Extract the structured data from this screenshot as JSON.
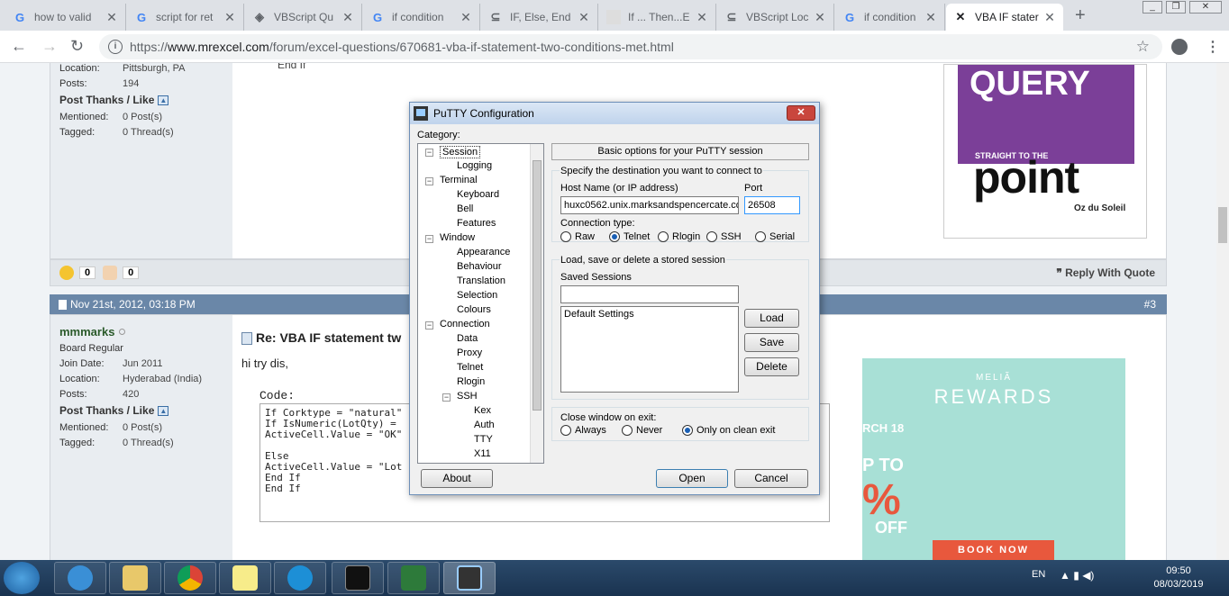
{
  "browser": {
    "tabs": [
      {
        "title": "how to valid",
        "icon": "G",
        "color": "#4285f4"
      },
      {
        "title": "script for ret",
        "icon": "G",
        "color": "#4285f4"
      },
      {
        "title": "VBScript Qu",
        "icon": "◈",
        "color": "#555"
      },
      {
        "title": "if condition",
        "icon": "G",
        "color": "#4285f4"
      },
      {
        "title": "IF, Else, End",
        "icon": "⊆",
        "color": "#555"
      },
      {
        "title": "If ... Then...E",
        "icon": "▫",
        "color": "#888"
      },
      {
        "title": "VBScript Loc",
        "icon": "⊆",
        "color": "#555"
      },
      {
        "title": "if condition",
        "icon": "G",
        "color": "#4285f4"
      },
      {
        "title": "VBA IF stater",
        "icon": "✕",
        "color": "#555"
      }
    ],
    "new_tab": "+",
    "url_prefix": "https://",
    "url_domain": "www.mrexcel.com",
    "url_path": "/forum/excel-questions/670681-vba-if-statement-two-conditions-met.html"
  },
  "post1": {
    "location_label": "Location:",
    "location": "Pittsburgh, PA",
    "posts_label": "Posts:",
    "posts": "194",
    "thanks": "Post Thanks / Like",
    "mentioned_label": "Mentioned:",
    "mentioned": "0 Post(s)",
    "tagged_label": "Tagged:",
    "tagged": "0 Thread(s)",
    "end_text": "End If",
    "likes": "0",
    "thumbs": "0",
    "reply_with_quote": "Reply With Quote"
  },
  "post2": {
    "date": "Nov 21st, 2012, 03:18 PM",
    "number": "#3",
    "username": "mmmarks",
    "rank": "Board Regular",
    "join_label": "Join Date:",
    "join": "Jun 2011",
    "location_label": "Location:",
    "location": "Hyderabad (India)",
    "posts_label": "Posts:",
    "posts": "420",
    "thanks": "Post Thanks / Like",
    "mentioned_label": "Mentioned:",
    "mentioned": "0 Post(s)",
    "tagged_label": "Tagged:",
    "tagged": "0 Thread(s)",
    "title": "Re: VBA IF statement tw",
    "body": "hi try dis,",
    "code_label": "Code:",
    "code": "If Corktype = \"natural\"\nIf IsNumeric(LotQty) =\nActiveCell.Value = \"OK\"\n\nElse\nActiveCell.Value = \"Lot\nEnd If\nEnd If"
  },
  "ads": {
    "query": "QUERY",
    "straight": "STRAIGHT TO THE",
    "point": "point",
    "author": "Oz du Soleil",
    "melia": "MELIÃ",
    "rewards": "REWARDS",
    "march": "RCH 18",
    "pto": "P TO",
    "pct": "%",
    "off": "OFF",
    "book": "BOOK NOW"
  },
  "putty": {
    "title": "PuTTY Configuration",
    "close": "✕",
    "category_label": "Category:",
    "tree": [
      {
        "label": "Session",
        "level": 0,
        "exp": "−",
        "selected": true
      },
      {
        "label": "Logging",
        "level": 1
      },
      {
        "label": "Terminal",
        "level": 0,
        "exp": "−"
      },
      {
        "label": "Keyboard",
        "level": 1
      },
      {
        "label": "Bell",
        "level": 1
      },
      {
        "label": "Features",
        "level": 1
      },
      {
        "label": "Window",
        "level": 0,
        "exp": "−"
      },
      {
        "label": "Appearance",
        "level": 1
      },
      {
        "label": "Behaviour",
        "level": 1
      },
      {
        "label": "Translation",
        "level": 1
      },
      {
        "label": "Selection",
        "level": 1
      },
      {
        "label": "Colours",
        "level": 1
      },
      {
        "label": "Connection",
        "level": 0,
        "exp": "−"
      },
      {
        "label": "Data",
        "level": 1
      },
      {
        "label": "Proxy",
        "level": 1
      },
      {
        "label": "Telnet",
        "level": 1
      },
      {
        "label": "Rlogin",
        "level": 1
      },
      {
        "label": "SSH",
        "level": 1,
        "exp": "−"
      },
      {
        "label": "Kex",
        "level": 2
      },
      {
        "label": "Auth",
        "level": 2
      },
      {
        "label": "TTY",
        "level": 2
      },
      {
        "label": "X11",
        "level": 2
      }
    ],
    "section_header": "Basic options for your PuTTY session",
    "dest_label": "Specify the destination you want to connect to",
    "host_label": "Host Name (or IP address)",
    "host_value": "huxc0562.unix.marksandspencercate.co",
    "port_label": "Port",
    "port_value": "26508",
    "conn_type_label": "Connection type:",
    "conn_types": [
      "Raw",
      "Telnet",
      "Rlogin",
      "SSH",
      "Serial"
    ],
    "conn_selected": "Telnet",
    "sessions_group_label": "Load, save or delete a stored session",
    "saved_sessions_label": "Saved Sessions",
    "saved_sessions_value": "",
    "sessions": [
      "Default Settings"
    ],
    "load": "Load",
    "save": "Save",
    "delete": "Delete",
    "close_exit_label": "Close window on exit:",
    "exit_options": [
      "Always",
      "Never",
      "Only on clean exit"
    ],
    "exit_selected": "Only on clean exit",
    "about": "About",
    "open": "Open",
    "cancel": "Cancel"
  },
  "taskbar": {
    "lang": "EN",
    "time": "09:50",
    "date": "08/03/2019"
  }
}
